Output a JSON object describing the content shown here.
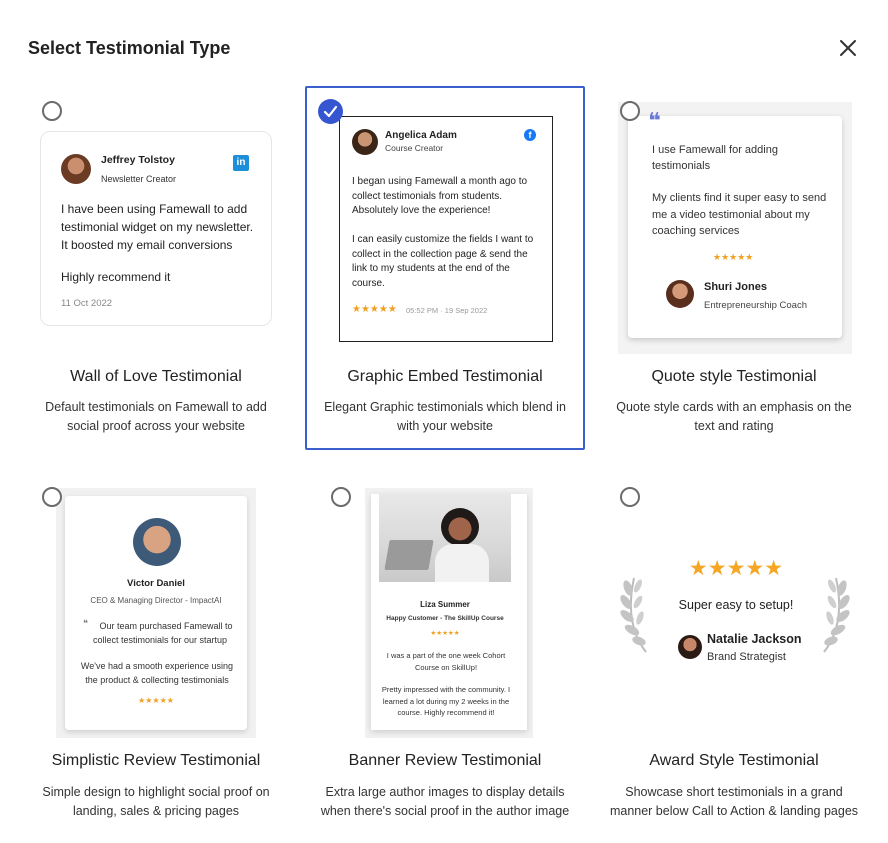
{
  "modal": {
    "title": "Select Testimonial Type",
    "close_icon": "close-icon"
  },
  "options": [
    {
      "title": "Wall of Love Testimonial",
      "description": "Default testimonials on Famewall to add social proof across your website",
      "selected": false,
      "preview": {
        "name": "Jeffrey Tolstoy",
        "role": "Newsletter Creator",
        "platform_icon": "linkedin-icon",
        "text": "I have been using Famewall to add testimonial widget on my newsletter. It boosted my email conversions",
        "text2": "Highly recommend it",
        "date": "11 Oct 2022"
      }
    },
    {
      "title": "Graphic Embed Testimonial",
      "description": "Elegant Graphic testimonials which blend in with your website",
      "selected": true,
      "preview": {
        "name": "Angelica Adam",
        "role": "Course Creator",
        "platform_icon": "facebook-icon",
        "text": "I began using Famewall a month ago to collect testimonials from students. Absolutely love the experience!",
        "text2": "I can easily customize the fields I want to collect in the collection page & send the link to my students at the end of the course.",
        "stars": "★★★★★",
        "date": "05:52 PM · 19 Sep 2022"
      }
    },
    {
      "title": "Quote style Testimonial",
      "description": "Quote style cards with an emphasis on the text and rating",
      "selected": false,
      "preview": {
        "quote_mark": "❝",
        "text": "I use Famewall for adding testimonials",
        "text2": "My clients find it super easy to send me a video testimonial about my coaching services",
        "stars": "★★★★★",
        "name": "Shuri Jones",
        "role": "Entrepreneurship Coach"
      }
    },
    {
      "title": "Simplistic Review Testimonial",
      "description": "Simple design to highlight social proof on landing, sales & pricing pages",
      "selected": false,
      "preview": {
        "name": "Victor Daniel",
        "role": "CEO & Managing Director - ImpactAI",
        "quote_mark": "❝",
        "text": "Our team purchased Famewall to collect testimonials for our startup",
        "text2": "We've had a smooth experience using the product & collecting testimonials",
        "stars": "★★★★★"
      }
    },
    {
      "title": "Banner Review Testimonial",
      "description": "Extra large author images to display details when there's social proof in the author image",
      "selected": false,
      "preview": {
        "name": "Liza Summer",
        "role": "Happy Customer - The SkillUp Course",
        "stars": "★★★★★",
        "text": "I was a part of the one week Cohort Course on SkillUp!",
        "text2": "Pretty impressed with the community. I learned a lot during my 2 weeks in the course. Highly recommend it!"
      }
    },
    {
      "title": "Award Style Testimonial",
      "description": "Showcase short testimonials in a grand manner below Call to Action & landing pages",
      "selected": false,
      "preview": {
        "stars": "★★★★★",
        "text": "Super easy to setup!",
        "name": "Natalie Jackson",
        "role": "Brand Strategist"
      }
    }
  ]
}
